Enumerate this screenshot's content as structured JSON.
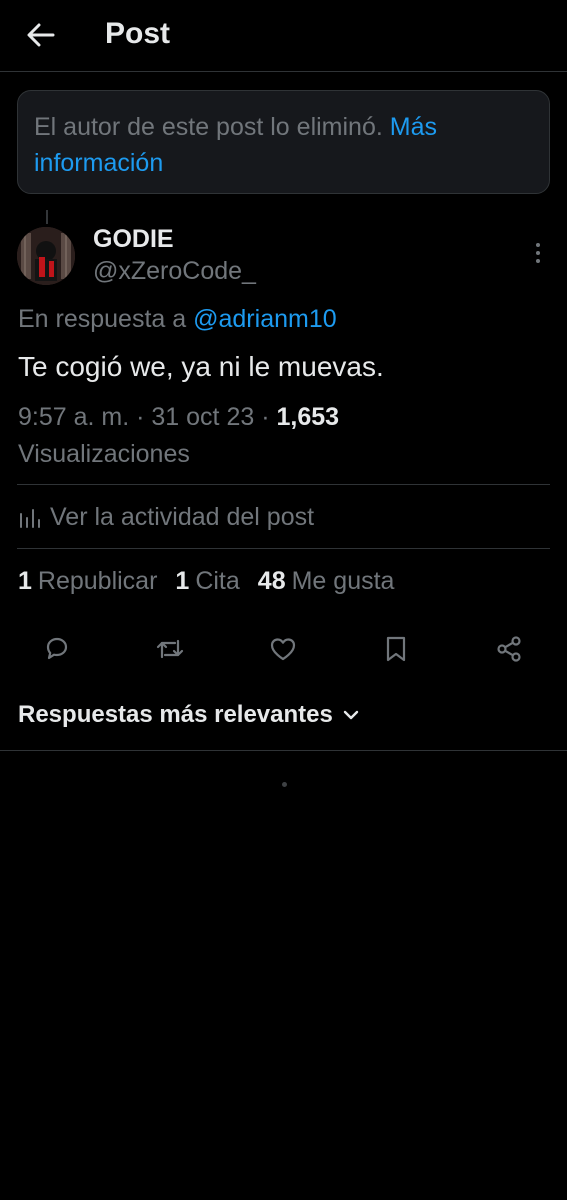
{
  "header": {
    "title": "Post"
  },
  "notice": {
    "text": "El autor de este post lo eliminó.",
    "link": "Más información"
  },
  "post": {
    "display_name": "GODIE",
    "handle": "@xZeroCode_",
    "reply_prefix": "En respuesta a",
    "reply_to": "@adrianm10",
    "text": "Te cogió we, ya ni le muevas.",
    "time": "9:57 a. m.",
    "date": "31 oct 23",
    "views_count": "1,653",
    "views_label": "Visualizaciones"
  },
  "activity_link": "Ver la actividad del post",
  "stats": {
    "reposts_count": "1",
    "reposts_label": "Republicar",
    "quotes_count": "1",
    "quotes_label": "Cita",
    "likes_count": "48",
    "likes_label": "Me gusta"
  },
  "sort": {
    "label": "Respuestas más relevantes"
  },
  "icons": [
    "back-arrow-icon",
    "more-options-icon",
    "analytics-icon",
    "reply-icon",
    "repost-icon",
    "like-icon",
    "bookmark-icon",
    "share-icon",
    "chevron-down-icon"
  ],
  "colors": {
    "background": "#000000",
    "text": "#e7e9ea",
    "secondary": "#71767b",
    "link": "#1d9bf0",
    "border": "#2f3336"
  }
}
